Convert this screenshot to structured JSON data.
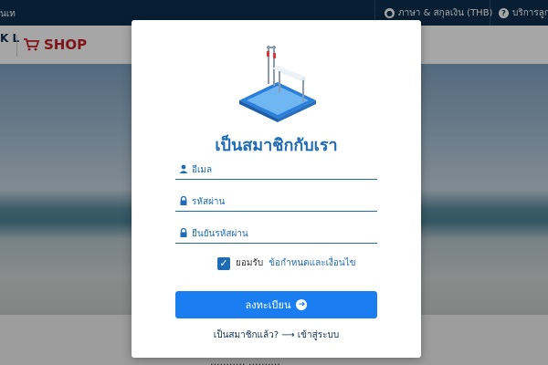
{
  "topbar": {
    "left_text": "นเท",
    "lang_currency": "ภาษา & สกุลเงิน (THB)",
    "help": "บริการลูก"
  },
  "header": {
    "logo_text": "K L",
    "shop_label": "SHOP"
  },
  "below": {
    "text": "........... .........."
  },
  "modal": {
    "title": "เป็นสมาชิกกับเรา",
    "fields": [
      {
        "icon": "user-icon",
        "placeholder": "อีเมล",
        "value": ""
      },
      {
        "icon": "lock-icon",
        "placeholder": "รหัสผ่าน",
        "value": ""
      },
      {
        "icon": "lock-icon",
        "placeholder": "ยืนยันรหัสผ่าน",
        "value": ""
      }
    ],
    "accept": {
      "label": "ยอมรับ",
      "terms_link": "ข้อกำหนดและเงื่อนไข",
      "checked": true
    },
    "register_label": "ลงทะเบียน",
    "login_prompt": "เป็นสมาชิกแล้ว?",
    "login_link": "เข้าสู่ระบบ"
  },
  "colors": {
    "navy": "#0d2f4f",
    "brand_blue": "#1f6bb5",
    "button_blue": "#1a7ef0",
    "shop_red": "#c42129"
  }
}
